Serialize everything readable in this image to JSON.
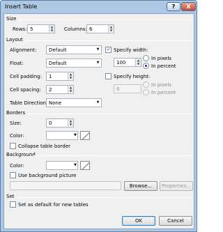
{
  "window": {
    "title": "Insert Table",
    "help_label": "?",
    "close_label": "X"
  },
  "size": {
    "heading": "Size",
    "rows_label": "Rows:",
    "rows_value": "5",
    "columns_label": "Columns:",
    "columns_value": "6"
  },
  "layout": {
    "heading": "Layout",
    "alignment_label": "Alignment:",
    "alignment_value": "Default",
    "specify_width_label": "Specify width:",
    "specify_width_checked": true,
    "width_value": "100",
    "in_pixels_label": "In pixels",
    "in_percent_label": "In percent",
    "float_label": "Float:",
    "float_value": "Default",
    "cell_padding_label": "Cell padding:",
    "cell_padding_value": "1",
    "specify_height_label": "Specify height:",
    "height_value": "0",
    "height_in_pixels_label": "In pixels",
    "height_in_percent_label": "In percent",
    "cell_spacing_label": "Cell spacing:",
    "cell_spacing_value": "2",
    "table_direction_label": "Table Direction:",
    "table_direction_value": "None"
  },
  "borders": {
    "heading": "Borders",
    "size_label": "Size:",
    "size_value": "0",
    "color_label": "Color:",
    "collapse_label": "Collapse table border"
  },
  "background": {
    "heading": "Background",
    "color_label": "Color:",
    "use_picture_label": "Use background picture",
    "browse_label": "Browse...",
    "properties_label": "Properties..."
  },
  "set": {
    "heading": "Set",
    "default_label": "Set as default for new tables"
  },
  "buttons": {
    "ok_label": "OK",
    "cancel_label": "Cancel"
  }
}
